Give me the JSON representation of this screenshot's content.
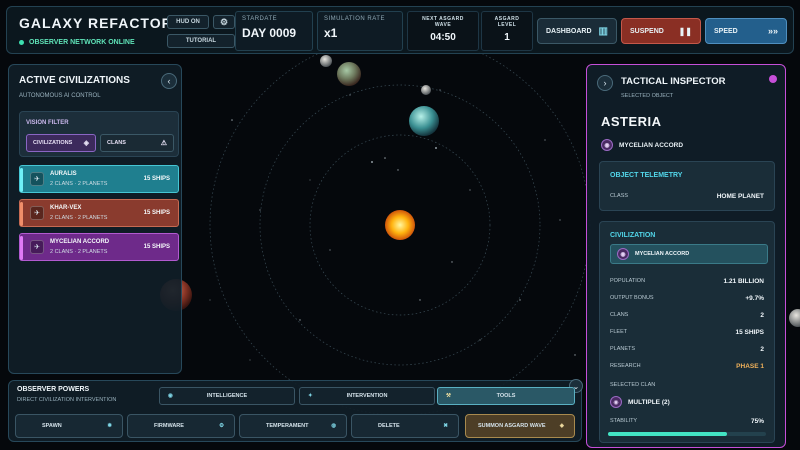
{
  "app": {
    "title": "GALAXY REFACTOR",
    "status": "OBSERVER NETWORK ONLINE"
  },
  "topbar": {
    "hud_label": "HUD ON",
    "tutorial_label": "TUTORIAL",
    "stardate": {
      "label": "STARDATE",
      "value": "DAY 0009"
    },
    "sim_rate": {
      "label": "SIMULATION RATE",
      "value": "x1"
    },
    "next_wave": {
      "label": "NEXT ASGARD WAVE",
      "value": "04:50"
    },
    "asgard_level": {
      "label": "ASGARD LEVEL",
      "value": "1"
    },
    "dashboard_label": "DASHBOARD",
    "suspend_label": "SUSPEND",
    "speed_label": "SPEED"
  },
  "left_panel": {
    "title": "ACTIVE CIVILIZATIONS",
    "subtitle": "AUTONOMOUS AI CONTROL",
    "filter_label": "VISION FILTER",
    "filters": [
      "CIVILIZATIONS",
      "CLANS"
    ],
    "civs": [
      {
        "name": "AURALIS",
        "meta": "2 CLANS · 2 PLANETS",
        "ships": "15 SHIPS",
        "color": "#1f7f8f",
        "accent": "#46e0ea"
      },
      {
        "name": "KHAR-VEX",
        "meta": "2 CLANS · 2 PLANETS",
        "ships": "15 SHIPS",
        "color": "#8a3b2e",
        "accent": "#e8825e"
      },
      {
        "name": "MYCELIAN ACCORD",
        "meta": "2 CLANS · 2 PLANETS",
        "ships": "15 SHIPS",
        "color": "#6e2a8a",
        "accent": "#d05ae8"
      }
    ]
  },
  "bottom_panel": {
    "title": "OBSERVER POWERS",
    "subtitle": "DIRECT CIVILIZATION INTERVENTION",
    "tabs": [
      "INTELLIGENCE",
      "INTERVENTION",
      "TOOLS"
    ],
    "powers": [
      "SPAWN",
      "FIRMWARE",
      "TEMPERAMENT",
      "DELETE",
      "SUMMON ASGARD WAVE"
    ]
  },
  "inspector": {
    "title": "TACTICAL INSPECTOR",
    "subtitle": "SELECTED OBJECT",
    "object_name": "ASTERIA",
    "civ_name": "MYCELIAN ACCORD",
    "telemetry": {
      "title": "OBJECT TELEMETRY",
      "class_label": "CLASS",
      "class_value": "HOME PLANET"
    },
    "civilization": {
      "title": "CIVILIZATION",
      "chip": "MYCELIAN ACCORD",
      "rows": [
        {
          "label": "POPULATION",
          "value": "1.21 BILLION"
        },
        {
          "label": "OUTPUT BONUS",
          "value": "+9.7%"
        },
        {
          "label": "CLANS",
          "value": "2"
        },
        {
          "label": "FLEET",
          "value": "15 SHIPS"
        },
        {
          "label": "PLANETS",
          "value": "2"
        },
        {
          "label": "RESEARCH",
          "value": "PHASE 1"
        }
      ],
      "selected_clan_label": "SELECTED CLAN",
      "selected_clan_value": "MULTIPLE (2)",
      "stability_label": "STABILITY",
      "stability_value": "75%",
      "stability_fraction": 0.75
    }
  },
  "colors": {
    "accent_teal": "#43e4c4",
    "inspector_border": "#c64fd9",
    "suspend": "#9e3a2e",
    "speed": "#2a6fa0",
    "research_phase": "#f0b15a"
  }
}
